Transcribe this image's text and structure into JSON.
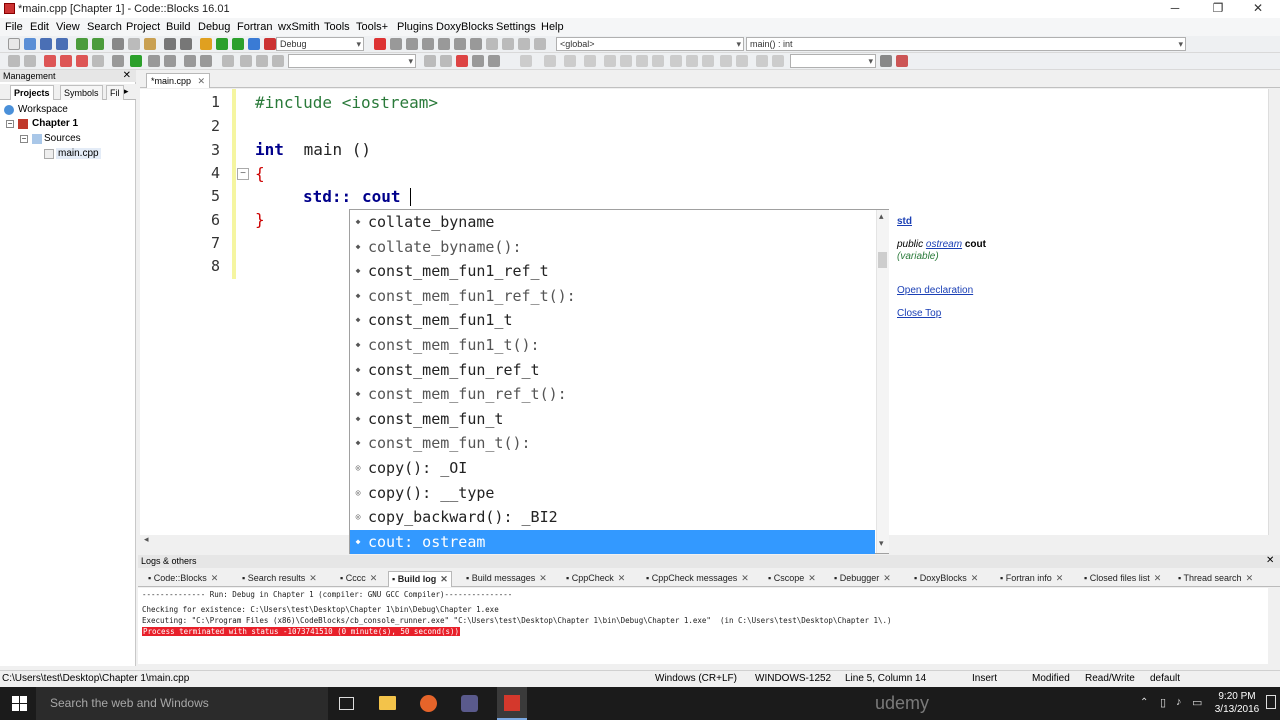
{
  "window": {
    "title": "*main.cpp [Chapter 1] - Code::Blocks 16.01"
  },
  "menu": [
    "File",
    "Edit",
    "View",
    "Search",
    "Project",
    "Build",
    "Debug",
    "Fortran",
    "wxSmith",
    "Tools",
    "Tools+",
    "Plugins",
    "DoxyBlocks",
    "Settings",
    "Help"
  ],
  "toolbar": {
    "build_target": "Debug",
    "scope": "<global>",
    "function": "main() : int"
  },
  "management": {
    "title": "Management",
    "tabs": [
      "Projects",
      "Symbols",
      "Fil"
    ],
    "tree": {
      "workspace": "Workspace",
      "project": "Chapter 1",
      "folder": "Sources",
      "file": "main.cpp"
    }
  },
  "editor": {
    "tab_label": "*main.cpp",
    "line_numbers": [
      "1",
      "2",
      "3",
      "4",
      "5",
      "6",
      "7",
      "8"
    ],
    "lines": {
      "l1": "#include <iostream>",
      "l3_kw": "int",
      "l3_rest": " main ()",
      "l4": "{",
      "l5_ns": "std::",
      "l5_id": "cout",
      "l6": "}"
    }
  },
  "autocomplete": {
    "items": [
      {
        "icon": "field-icon",
        "text": "collate_byname"
      },
      {
        "icon": "function-icon",
        "text": "collate_byname():"
      },
      {
        "icon": "field-icon",
        "text": "const_mem_fun1_ref_t"
      },
      {
        "icon": "function-icon",
        "text": "const_mem_fun1_ref_t():"
      },
      {
        "icon": "field-icon",
        "text": "const_mem_fun1_t"
      },
      {
        "icon": "function-icon",
        "text": "const_mem_fun1_t():"
      },
      {
        "icon": "field-icon",
        "text": "const_mem_fun_ref_t"
      },
      {
        "icon": "function-icon",
        "text": "const_mem_fun_ref_t():"
      },
      {
        "icon": "field-icon",
        "text": "const_mem_fun_t"
      },
      {
        "icon": "function-icon",
        "text": "const_mem_fun_t():"
      },
      {
        "icon": "function-icon",
        "text": "copy(): _OI"
      },
      {
        "icon": "function-icon",
        "text": "copy(): __type"
      },
      {
        "icon": "function-icon",
        "text": "copy_backward(): _BI2"
      },
      {
        "icon": "field-icon",
        "text": "cout: ostream"
      }
    ],
    "selected_index": 13
  },
  "info_panel": {
    "namespace": "std",
    "signature_prefix": "public",
    "signature_type": "ostream",
    "signature_name": "cout",
    "kind": "(variable)",
    "open_declaration": "Open declaration",
    "close_top": "Close Top"
  },
  "logs": {
    "title": "Logs & others",
    "tabs": [
      "Code::Blocks",
      "Search results",
      "Cccc",
      "Build log",
      "Build messages",
      "CppCheck",
      "CppCheck messages",
      "Cscope",
      "Debugger",
      "DoxyBlocks",
      "Fortran info",
      "Closed files list",
      "Thread search"
    ],
    "active_tab": "Build log",
    "lines": [
      "-------------- Run: Debug in Chapter 1 (compiler: GNU GCC Compiler)---------------",
      "Checking for existence: C:\\Users\\test\\Desktop\\Chapter 1\\bin\\Debug\\Chapter 1.exe",
      "Executing: \"C:\\Program Files (x86)\\CodeBlocks/cb_console_runner.exe\" \"C:\\Users\\test\\Desktop\\Chapter 1\\bin\\Debug\\Chapter 1.exe\"  (in C:\\Users\\test\\Desktop\\Chapter 1\\.)",
      "Process terminated with status -1073741510 (0 minute(s), 50 second(s))"
    ],
    "error_color": "#e8202a"
  },
  "status": {
    "path": "C:\\Users\\test\\Desktop\\Chapter 1\\main.cpp",
    "eol": "Windows (CR+LF)",
    "encoding": "WINDOWS-1252",
    "position": "Line 5, Column 14",
    "mode": "Insert",
    "modified": "Modified",
    "access": "Read/Write",
    "profile": "default"
  },
  "taskbar": {
    "search_placeholder": "Search the web and Windows",
    "watermark": "udemy",
    "time": "9:20 PM",
    "date": "3/13/2016"
  },
  "colors": {
    "selection": "#3399ff",
    "keyword": "#00008b",
    "preprocessor": "#008040",
    "link": "#1a3fb5"
  }
}
